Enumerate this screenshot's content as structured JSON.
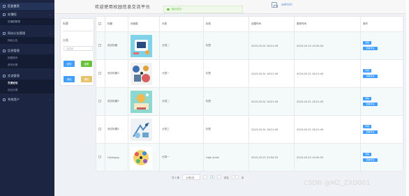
{
  "sidebar": {
    "home": "后台首页",
    "groups": [
      {
        "label": "轮播图",
        "subs": [
          "轮播图管理"
        ]
      },
      {
        "label": "网站公告管理",
        "subs": [
          "网站公告"
        ]
      },
      {
        "label": "信息管理",
        "subs": [
          "校园资讯",
          "资讯分类"
        ]
      },
      {
        "label": "交流管理",
        "subs": [
          "交流论坛",
          "论坛分类"
        ]
      },
      {
        "label": "系统用户",
        "subs": []
      }
    ]
  },
  "header": {
    "title": "欢迎使用校园信息交流平台",
    "toast": "退出成功!",
    "user": "admin"
  },
  "filter": {
    "title_label": "标题",
    "category_label": "分类",
    "category_placeholder": "请选择",
    "query": "查询",
    "reset": "重置",
    "add": "添加",
    "delete": "删除"
  },
  "table": {
    "headers": [
      "标题",
      "封面图",
      "分类",
      "标签",
      "创建时间",
      "更新时间",
      "操作"
    ],
    "rows": [
      {
        "title": "测试标题",
        "category": "分类二",
        "tag": "标签",
        "created": "2023-03-31 18:21:49",
        "updated": "2023-03-25 19:35:54"
      },
      {
        "title": "测试标题3",
        "category": "分类一",
        "tag": "标签",
        "created": "2023-03-31 18:21:49",
        "updated": "2023-03-31 18:21:49"
      },
      {
        "title": "测试标题5",
        "category": "分类二",
        "tag": "标签",
        "created": "2023-03-31 18:21:49",
        "updated": "2023-03-31 18:21:49"
      },
      {
        "title": "测试标题4",
        "category": "分类三",
        "tag": "标签",
        "created": "2023-03-31 18:21:49",
        "updated": "2023-03-31 18:21:49"
      },
      {
        "title": "Hiyhkgsg",
        "category": "分类一",
        "tag": "High zhhhl",
        "created": "2023-03-25 19:34:55",
        "updated": "2023-03-25 19:34:55"
      }
    ],
    "action_detail": "详情",
    "action_comment": "查看评论"
  },
  "pager": {
    "total": "共 5 条",
    "size": "10条/页",
    "prev": "‹",
    "page": "1",
    "next": "›",
    "goto": "前往",
    "goto_value": "1",
    "page_suffix": "页"
  },
  "watermark": "CSDN @MZ_ZXD001",
  "colors": {
    "sidebar": "#1c2541",
    "primary": "#409eff",
    "success": "#67c23a",
    "warning": "#e6c36a"
  }
}
